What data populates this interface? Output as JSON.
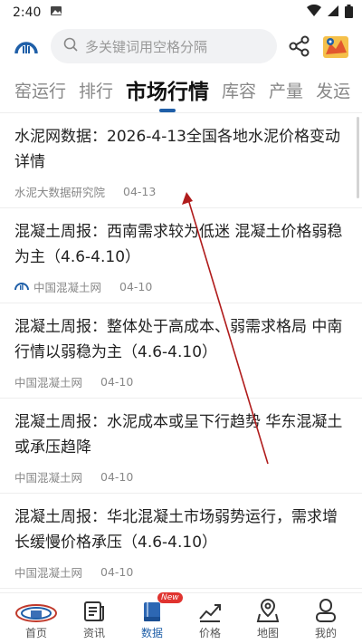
{
  "status": {
    "time": "2:40"
  },
  "search": {
    "placeholder": "多关键词用空格分隔"
  },
  "tabs": [
    {
      "label": "窑运行",
      "active": false
    },
    {
      "label": "排行",
      "active": false
    },
    {
      "label": "市场行情",
      "active": true
    },
    {
      "label": "库容",
      "active": false
    },
    {
      "label": "产量",
      "active": false
    },
    {
      "label": "发运",
      "active": false
    }
  ],
  "articles": [
    {
      "title": "水泥网数据：2026-4-13全国各地水泥价格变动详情",
      "source": "水泥大数据研究院",
      "date": "04-13",
      "source_icon": false
    },
    {
      "title": "混凝土周报：西南需求较为低迷 混凝土价格弱稳为主（4.6-4.10）",
      "source": "中国混凝土网",
      "date": "04-10",
      "source_icon": true
    },
    {
      "title": "混凝土周报：整体处于高成本、弱需求格局 中南行情以弱稳为主（4.6-4.10）",
      "source": "中国混凝土网",
      "date": "04-10",
      "source_icon": false
    },
    {
      "title": "混凝土周报：水泥成本或呈下行趋势 华东混凝土或承压趋降",
      "source": "中国混凝土网",
      "date": "04-10",
      "source_icon": false
    },
    {
      "title": "混凝土周报：华北混凝土市场弱势运行，需求增长缓慢价格承压（4.6-4.10）",
      "source": "中国混凝土网",
      "date": "04-10",
      "source_icon": false
    }
  ],
  "nav": [
    {
      "label": "首页",
      "icon": "home-logo-icon"
    },
    {
      "label": "资讯",
      "icon": "news-icon"
    },
    {
      "label": "数据",
      "icon": "data-book-icon",
      "badge": "New",
      "active": true
    },
    {
      "label": "价格",
      "icon": "trend-chart-icon"
    },
    {
      "label": "地图",
      "icon": "map-pin-icon"
    },
    {
      "label": "我的",
      "icon": "user-icon"
    }
  ],
  "colors": {
    "accent": "#1f5fa8",
    "badge": "#e0332f",
    "arrow": "#b01c1c"
  }
}
